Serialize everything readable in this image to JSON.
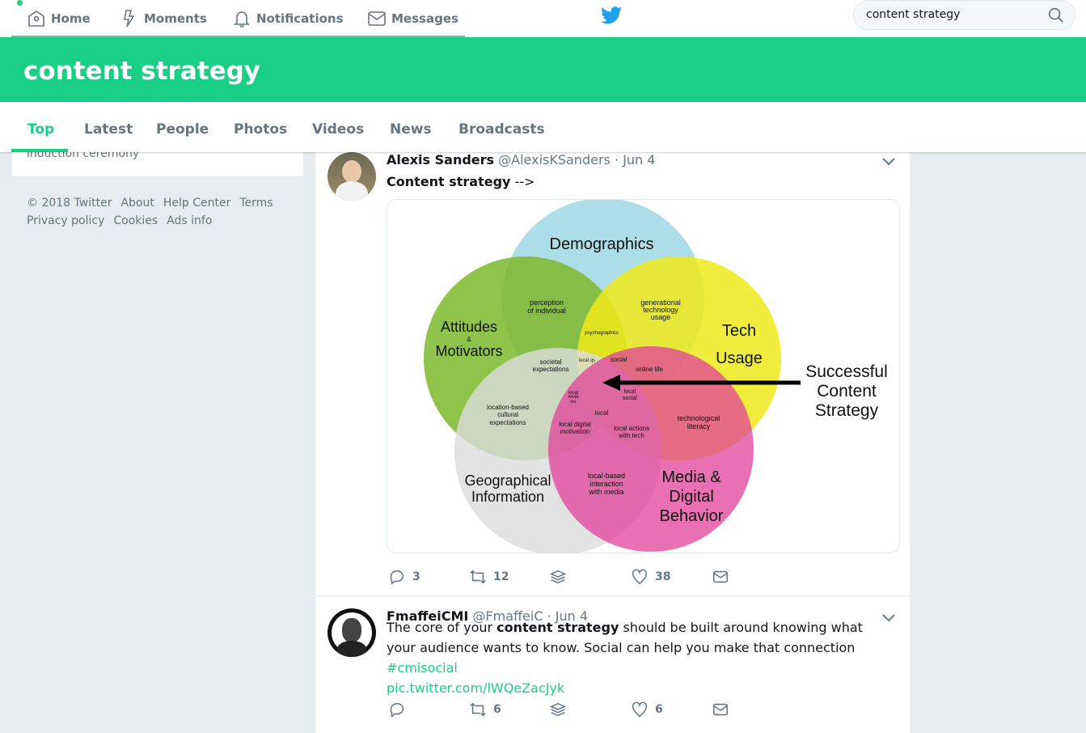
{
  "nav": {
    "items": [
      {
        "label": "Home",
        "icon": "home-icon"
      },
      {
        "label": "Moments",
        "icon": "lightning-icon"
      },
      {
        "label": "Notifications",
        "icon": "bell-icon"
      },
      {
        "label": "Messages",
        "icon": "envelope-icon"
      }
    ],
    "logo": "twitter-bird-icon"
  },
  "search": {
    "value": "content strategy"
  },
  "banner": {
    "title": "content strategy"
  },
  "tabs": [
    {
      "label": "Top",
      "active": true
    },
    {
      "label": "Latest"
    },
    {
      "label": "People"
    },
    {
      "label": "Photos"
    },
    {
      "label": "Videos"
    },
    {
      "label": "News"
    },
    {
      "label": "Broadcasts"
    }
  ],
  "left_card": {
    "text": "induction ceremony"
  },
  "footer": {
    "links": [
      "© 2018 Twitter",
      "About",
      "Help Center",
      "Terms",
      "Privacy policy",
      "Cookies",
      "Ads info"
    ]
  },
  "colors": {
    "accent": "#19cf86",
    "twitter_blue": "#1da1f2"
  },
  "tweets": [
    {
      "name": "Alexis Sanders",
      "handle": "@AlexisKSanders",
      "date": "· Jun 4",
      "text_bold": "Content strategy",
      "text_rest": " -->",
      "venn": {
        "circles": [
          "Demographics",
          "Attitudes",
          "Motivators",
          "Tech",
          "Usage",
          "Geographical",
          "Information",
          "Media &",
          "Digital",
          "Behavior"
        ],
        "amp": "&",
        "overlaps": [
          "perception",
          "of individual",
          "generational",
          "technology",
          "usage",
          "psychographics",
          "societal",
          "expectations",
          "local qs",
          "social",
          "online life",
          "local",
          "revie",
          "ws",
          "local",
          "social",
          "location-based",
          "cultural",
          "expectations",
          "local",
          "local digital",
          "motivation",
          "local actions",
          "with tech",
          "technological",
          "literacy",
          "local-based",
          "interaction",
          "with media"
        ],
        "callout": [
          "Successful",
          "Content",
          "Strategy"
        ]
      },
      "replies": "3",
      "retweets": "12",
      "likes": "38"
    },
    {
      "name": "FmaffeiCMI",
      "handle": "@FmaffeiC",
      "date": "· Jun 4",
      "text_a": "The core of your ",
      "text_bold": "content strategy",
      "text_b": " should be built around knowing what your audience wants to know. Social can help you make that connection ",
      "hashtag": "#cmisocial",
      "link": "pic.twitter.com/lWQeZacJyk",
      "replies": "",
      "retweets": "6",
      "likes": "6"
    }
  ]
}
